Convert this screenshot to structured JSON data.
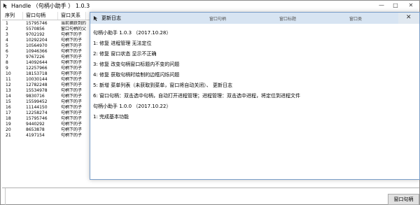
{
  "window": {
    "title": "Handle （句柄小助手 ） 1.0.3",
    "minimize": "—",
    "maximize": "□",
    "close": "✕"
  },
  "table": {
    "headers": [
      "序列",
      "窗口句柄",
      "窗口关系",
      ""
    ],
    "rows": [
      {
        "index": "1",
        "handle": "15795746",
        "relation": "当前捕获到的"
      },
      {
        "index": "2",
        "handle": "5570856",
        "relation": "窗口句柄的父"
      },
      {
        "index": "3",
        "handle": "9702192",
        "relation": "句柄下的子"
      },
      {
        "index": "4",
        "handle": "10292204",
        "relation": "句柄下的子"
      },
      {
        "index": "5",
        "handle": "10564970",
        "relation": "句柄下的子"
      },
      {
        "index": "6",
        "handle": "10946366",
        "relation": "句柄下的子"
      },
      {
        "index": "7",
        "handle": "9767226",
        "relation": "句柄下的子"
      },
      {
        "index": "8",
        "handle": "14092644",
        "relation": "句柄下的子"
      },
      {
        "index": "9",
        "handle": "12257966",
        "relation": "句柄下的子"
      },
      {
        "index": "10",
        "handle": "18153718",
        "relation": "句柄下的子"
      },
      {
        "index": "11",
        "handle": "10030144",
        "relation": "句柄下的子"
      },
      {
        "index": "12",
        "handle": "12782248",
        "relation": "句柄下的子"
      },
      {
        "index": "13",
        "handle": "15534978",
        "relation": "句柄下的子"
      },
      {
        "index": "14",
        "handle": "9830716",
        "relation": "句柄下的子"
      },
      {
        "index": "15",
        "handle": "15599452",
        "relation": "句柄下的子"
      },
      {
        "index": "16",
        "handle": "11144150",
        "relation": "句柄下的子"
      },
      {
        "index": "17",
        "handle": "12258274",
        "relation": "句柄下的子"
      },
      {
        "index": "18",
        "handle": "15795746",
        "relation": "句柄下的子"
      },
      {
        "index": "19",
        "handle": "9440292",
        "relation": "句柄下的子"
      },
      {
        "index": "20",
        "handle": "8653878",
        "relation": "句柄下的子"
      },
      {
        "index": "21",
        "handle": "4197154",
        "relation": "句柄下的子"
      }
    ]
  },
  "bottom": {
    "button_label": "窗口句柄"
  },
  "dialog": {
    "title": "更新日志",
    "close": "✕",
    "header_extra": [
      "窗口句柄",
      "窗口标题",
      "窗口类"
    ],
    "lines": [
      "句柄小助手 1.0.3 （2017.10.28）",
      "1: 修复 进程管理 无法定位",
      "2: 修复 窗口状态 显示不正确",
      "3: 修复 改变句柄窗口标题内不变的问题",
      "4: 修复 获取句柄时绘制的边框闪烁问题",
      "5: 新增 菜单列表（未获取到菜单，窗口将自动关闭）、 更新日志",
      "6: 窗口句柄：双击选中句柄，自动打开进程管理；进程管理：双击选中进程，将定位到进程文件",
      "句柄小助手 1.0.0 （2017.10.22）",
      "1: 完成基本功能"
    ]
  },
  "colors": {
    "dialog_titlebar": "#d7e4f2",
    "dialog_border": "#7a9ec8"
  }
}
